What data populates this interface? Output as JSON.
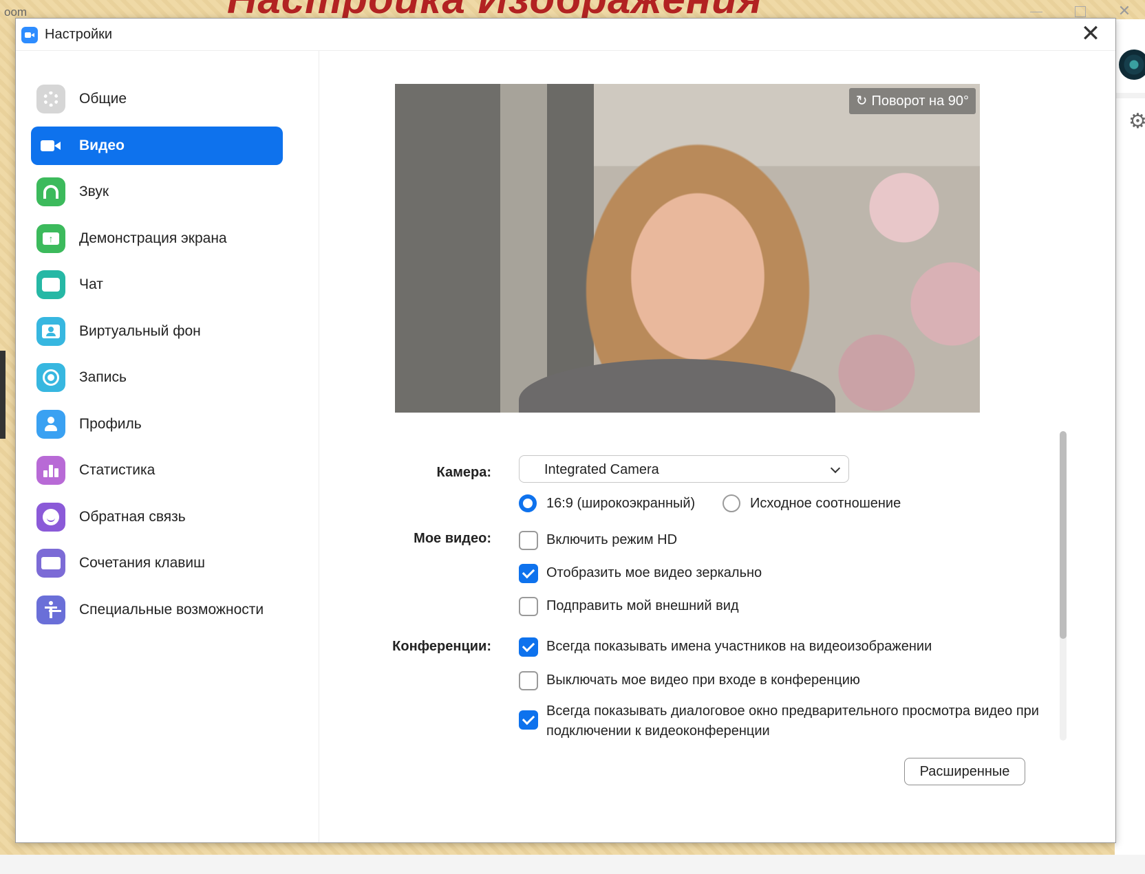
{
  "background": {
    "banner_text": "Настройка  Изображения",
    "app_label": "oom",
    "window_controls": {
      "minimize": "",
      "maximize": "",
      "close": "✕"
    }
  },
  "dialog": {
    "title": "Настройки",
    "close_glyph": "✕"
  },
  "sidebar": {
    "items": [
      {
        "label": "Общие",
        "icon": "gear-icon",
        "color": "#d6d6d6",
        "active": false
      },
      {
        "label": "Видео",
        "icon": "video-camera-icon",
        "color": "#0e72ed",
        "active": true
      },
      {
        "label": "Звук",
        "icon": "headphones-icon",
        "color": "#3cba5c",
        "active": false
      },
      {
        "label": "Демонстрация экрана",
        "icon": "share-screen-icon",
        "color": "#3cba5c",
        "active": false
      },
      {
        "label": "Чат",
        "icon": "chat-icon",
        "color": "#26b8a5",
        "active": false
      },
      {
        "label": "Виртуальный фон",
        "icon": "virtual-background-icon",
        "color": "#37b7e0",
        "active": false
      },
      {
        "label": "Запись",
        "icon": "record-icon",
        "color": "#37b7e0",
        "active": false
      },
      {
        "label": "Профиль",
        "icon": "profile-icon",
        "color": "#3aa1f2",
        "active": false
      },
      {
        "label": "Статистика",
        "icon": "statistics-icon",
        "color": "#b86ad6",
        "active": false
      },
      {
        "label": "Обратная связь",
        "icon": "feedback-smile-icon",
        "color": "#8b5ad8",
        "active": false
      },
      {
        "label": "Сочетания клавиш",
        "icon": "keyboard-icon",
        "color": "#7c6bd6",
        "active": false
      },
      {
        "label": "Специальные возможности",
        "icon": "accessibility-icon",
        "color": "#6a6fd8",
        "active": false
      }
    ]
  },
  "video": {
    "rotate_label": "Поворот на 90°",
    "camera_label": "Камера:",
    "camera_value": "Integrated Camera",
    "aspect_options": [
      {
        "label": "16:9 (широкоэкранный)",
        "selected": true
      },
      {
        "label": "Исходное соотношение",
        "selected": false
      }
    ],
    "my_video_label": "Мое видео:",
    "my_video_options": [
      {
        "label": "Включить режим HD",
        "checked": false
      },
      {
        "label": "Отобразить мое видео зеркально",
        "checked": true
      },
      {
        "label": "Подправить мой внешний вид",
        "checked": false
      }
    ],
    "conferences_label": "Конференции:",
    "conference_options": [
      {
        "label": "Всегда показывать имена участников на видеоизображении",
        "checked": true
      },
      {
        "label": "Выключать мое видео при входе в конференцию",
        "checked": false
      },
      {
        "label": "Всегда показывать диалоговое окно предварительного просмотра видео при подключении к видеоконференции",
        "checked": true
      }
    ],
    "advanced_button": "Расширенные"
  },
  "colors": {
    "accent": "#0e72ed",
    "checkbox_off": "#9a9a9a"
  }
}
